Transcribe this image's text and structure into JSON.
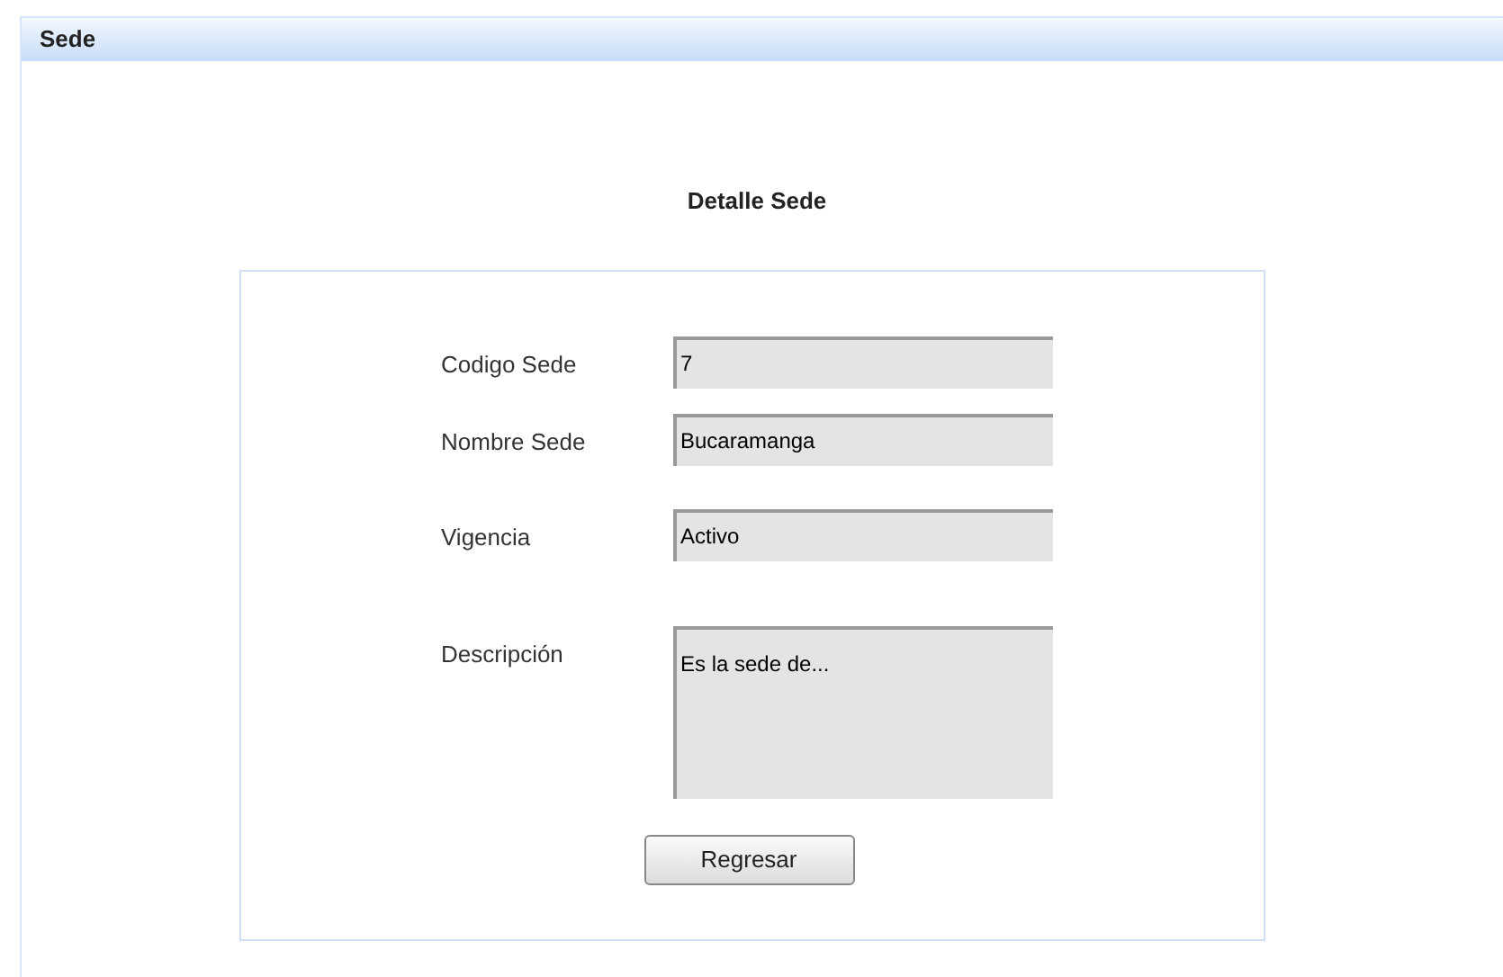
{
  "panel": {
    "title": "Sede"
  },
  "heading": "Detalle Sede",
  "fields": [
    {
      "label": "Codigo Sede",
      "kind": "text",
      "value": "7"
    },
    {
      "label": "Nombre Sede",
      "kind": "text",
      "value": "Bucaramanga"
    },
    {
      "label": "Vigencia",
      "kind": "text",
      "value": "Activo"
    },
    {
      "label": "Descripción",
      "kind": "textarea",
      "value": "Es la sede de..."
    }
  ],
  "buttons": [
    "Regresar"
  ]
}
